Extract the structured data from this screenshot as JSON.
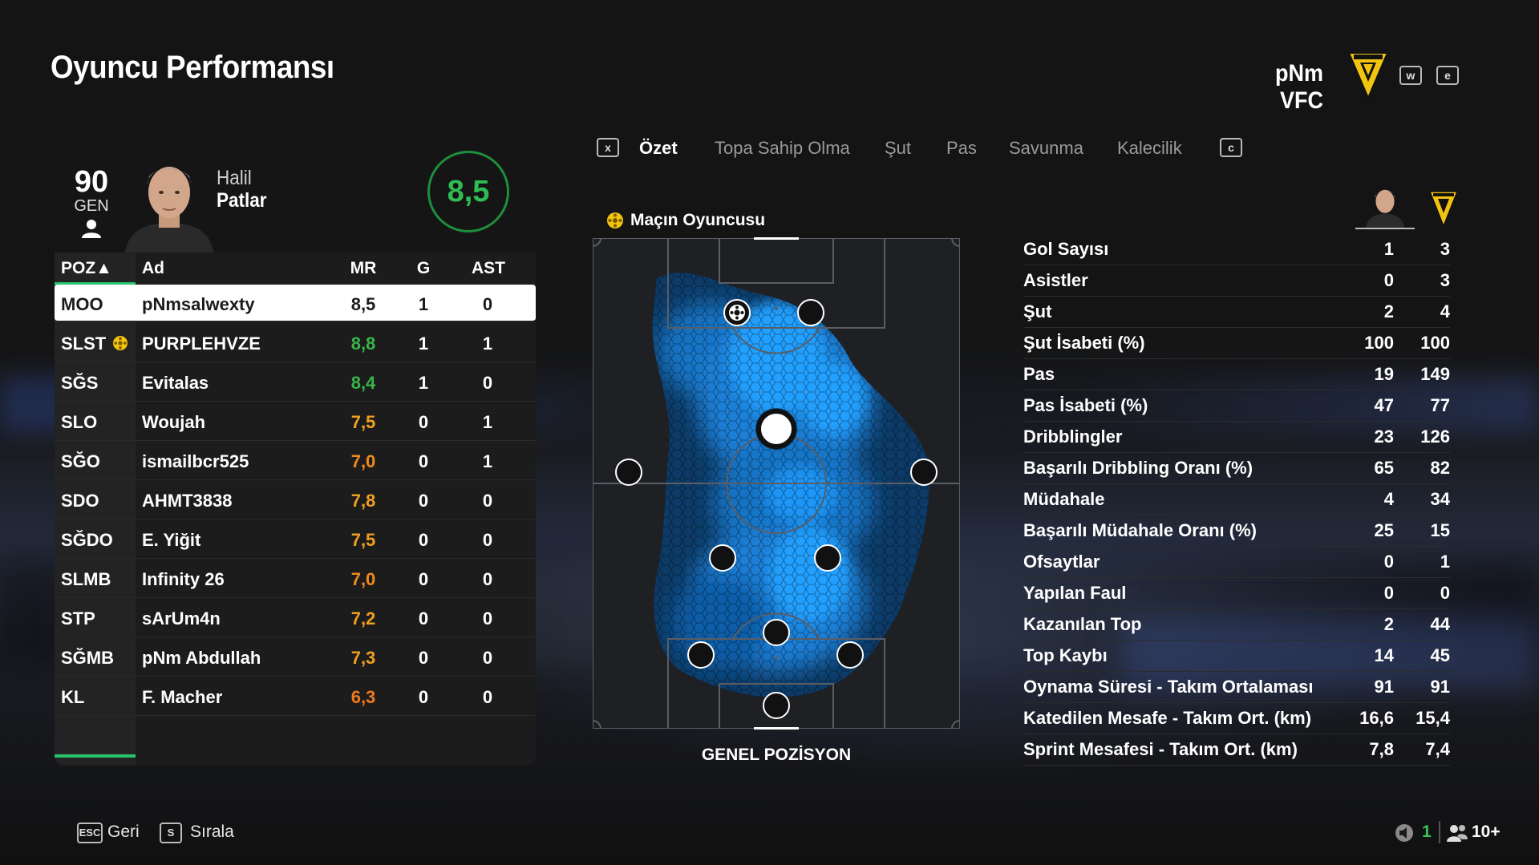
{
  "page": {
    "title": "Oyuncu Performansı"
  },
  "club": {
    "name": "pNm VFC",
    "key_prev": "w",
    "key_next": "e"
  },
  "player_card": {
    "overall": "90",
    "overall_label": "GEN",
    "first_name": "Halil",
    "last_name": "Patlar",
    "rating": "8,5"
  },
  "table": {
    "headers": {
      "pos": "POZ▲",
      "name": "Ad",
      "mr": "MR",
      "g": "G",
      "ast": "AST"
    },
    "rows": [
      {
        "pos": "MOO",
        "name": "pNmsalwexty",
        "mr": "8,5",
        "g": "1",
        "ast": "0",
        "mr_color": "#1b1b1b",
        "selected": true,
        "motm": false
      },
      {
        "pos": "SLST",
        "name": "PURPLEHVZE",
        "mr": "8,8",
        "g": "1",
        "ast": "1",
        "mr_color": "#39b54a",
        "selected": false,
        "motm": true
      },
      {
        "pos": "SĞS",
        "name": "Evitalas",
        "mr": "8,4",
        "g": "1",
        "ast": "0",
        "mr_color": "#39b54a",
        "selected": false,
        "motm": false
      },
      {
        "pos": "SLO",
        "name": "Woujah",
        "mr": "7,5",
        "g": "0",
        "ast": "1",
        "mr_color": "#f0a020",
        "selected": false,
        "motm": false
      },
      {
        "pos": "SĞO",
        "name": "ismailbcr525",
        "mr": "7,0",
        "g": "0",
        "ast": "1",
        "mr_color": "#f08a1c",
        "selected": false,
        "motm": false
      },
      {
        "pos": "SDO",
        "name": "AHMT3838",
        "mr": "7,8",
        "g": "0",
        "ast": "0",
        "mr_color": "#f0a020",
        "selected": false,
        "motm": false
      },
      {
        "pos": "SĞDO",
        "name": "E. Yiğit",
        "mr": "7,5",
        "g": "0",
        "ast": "0",
        "mr_color": "#f0a020",
        "selected": false,
        "motm": false
      },
      {
        "pos": "SLMB",
        "name": "Infinity 26",
        "mr": "7,0",
        "g": "0",
        "ast": "0",
        "mr_color": "#f08a1c",
        "selected": false,
        "motm": false
      },
      {
        "pos": "STP",
        "name": "sArUm4n",
        "mr": "7,2",
        "g": "0",
        "ast": "0",
        "mr_color": "#f0a020",
        "selected": false,
        "motm": false
      },
      {
        "pos": "SĞMB",
        "name": "pNm Abdullah",
        "mr": "7,3",
        "g": "0",
        "ast": "0",
        "mr_color": "#f0a020",
        "selected": false,
        "motm": false
      },
      {
        "pos": "KL",
        "name": "F. Macher",
        "mr": "6,3",
        "g": "0",
        "ast": "0",
        "mr_color": "#f07a1c",
        "selected": false,
        "motm": false
      }
    ]
  },
  "tabs": {
    "key_left": "x",
    "key_right": "c",
    "items": [
      "Özet",
      "Topa Sahip Olma",
      "Şut",
      "Pas",
      "Savunma",
      "Kalecilik"
    ],
    "active_index": 0
  },
  "motm_label": "Maçın Oyuncusu",
  "pitch_caption": "GENEL POZİSYON",
  "stats": [
    {
      "label": "Gol Sayısı",
      "player": "1",
      "team": "3"
    },
    {
      "label": "Asistler",
      "player": "0",
      "team": "3"
    },
    {
      "label": "Şut",
      "player": "2",
      "team": "4"
    },
    {
      "label": "Şut İsabeti (%)",
      "player": "100",
      "team": "100"
    },
    {
      "label": "Pas",
      "player": "19",
      "team": "149"
    },
    {
      "label": "Pas İsabeti (%)",
      "player": "47",
      "team": "77"
    },
    {
      "label": "Dribblingler",
      "player": "23",
      "team": "126"
    },
    {
      "label": "Başarılı Dribbling Oranı (%)",
      "player": "65",
      "team": "82"
    },
    {
      "label": "Müdahale",
      "player": "4",
      "team": "34"
    },
    {
      "label": "Başarılı Müdahale Oranı (%)",
      "player": "25",
      "team": "15"
    },
    {
      "label": "Ofsaytlar",
      "player": "0",
      "team": "1"
    },
    {
      "label": "Yapılan Faul",
      "player": "0",
      "team": "0"
    },
    {
      "label": "Kazanılan Top",
      "player": "2",
      "team": "44"
    },
    {
      "label": "Top Kaybı",
      "player": "14",
      "team": "45"
    },
    {
      "label": "Oynama Süresi - Takım Ortalaması",
      "player": "91",
      "team": "91"
    },
    {
      "label": "Katedilen Mesafe - Takım Ort. (km)",
      "player": "16,6",
      "team": "15,4"
    },
    {
      "label": "Sprint Mesafesi - Takım Ort. (km)",
      "player": "7,8",
      "team": "7,4"
    }
  ],
  "footer": {
    "back_key": "ESC",
    "back_label": "Geri",
    "sort_key": "S",
    "sort_label": "Sırala",
    "voice_count": "1",
    "players_count": "10+"
  },
  "colors": {
    "accent_green": "#28c36a",
    "rating_ring": "#1e8f3c",
    "heatmap": "#1e90ff",
    "motm_yellow": "#f2c40f"
  }
}
